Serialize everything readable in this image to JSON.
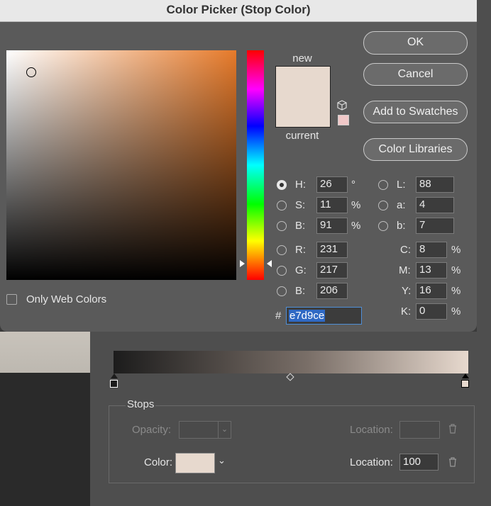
{
  "dialog": {
    "title": "Color Picker (Stop Color)",
    "new_label": "new",
    "current_label": "current",
    "new_color": "#e7d9ce",
    "current_color": "#e7d9ce",
    "web_swatch_color": "#f0c8c8",
    "only_web_colors": "Only Web Colors",
    "buttons": {
      "ok": "OK",
      "cancel": "Cancel",
      "add_to_swatches": "Add to Swatches",
      "color_libraries": "Color Libraries"
    },
    "hsb": [
      {
        "label": "H:",
        "value": "26",
        "unit": "°"
      },
      {
        "label": "S:",
        "value": "11",
        "unit": "%"
      },
      {
        "label": "B:",
        "value": "91",
        "unit": "%"
      }
    ],
    "rgb": [
      {
        "label": "R:",
        "value": "231"
      },
      {
        "label": "G:",
        "value": "217"
      },
      {
        "label": "B:",
        "value": "206"
      }
    ],
    "lab": [
      {
        "label": "L:",
        "value": "88"
      },
      {
        "label": "a:",
        "value": "4"
      },
      {
        "label": "b:",
        "value": "7"
      }
    ],
    "cmyk": [
      {
        "label": "C:",
        "value": "8",
        "unit": "%"
      },
      {
        "label": "M:",
        "value": "13",
        "unit": "%"
      },
      {
        "label": "Y:",
        "value": "16",
        "unit": "%"
      },
      {
        "label": "K:",
        "value": "0",
        "unit": "%"
      }
    ],
    "hex_symbol": "#",
    "hex": "e7d9ce"
  },
  "gradient_editor": {
    "stops_title": "Stops",
    "opacity_label": "Opacity:",
    "location_label": "Location:",
    "color_label": "Color:",
    "color_location_value": "100",
    "stop_color": "#e7d9ce"
  }
}
